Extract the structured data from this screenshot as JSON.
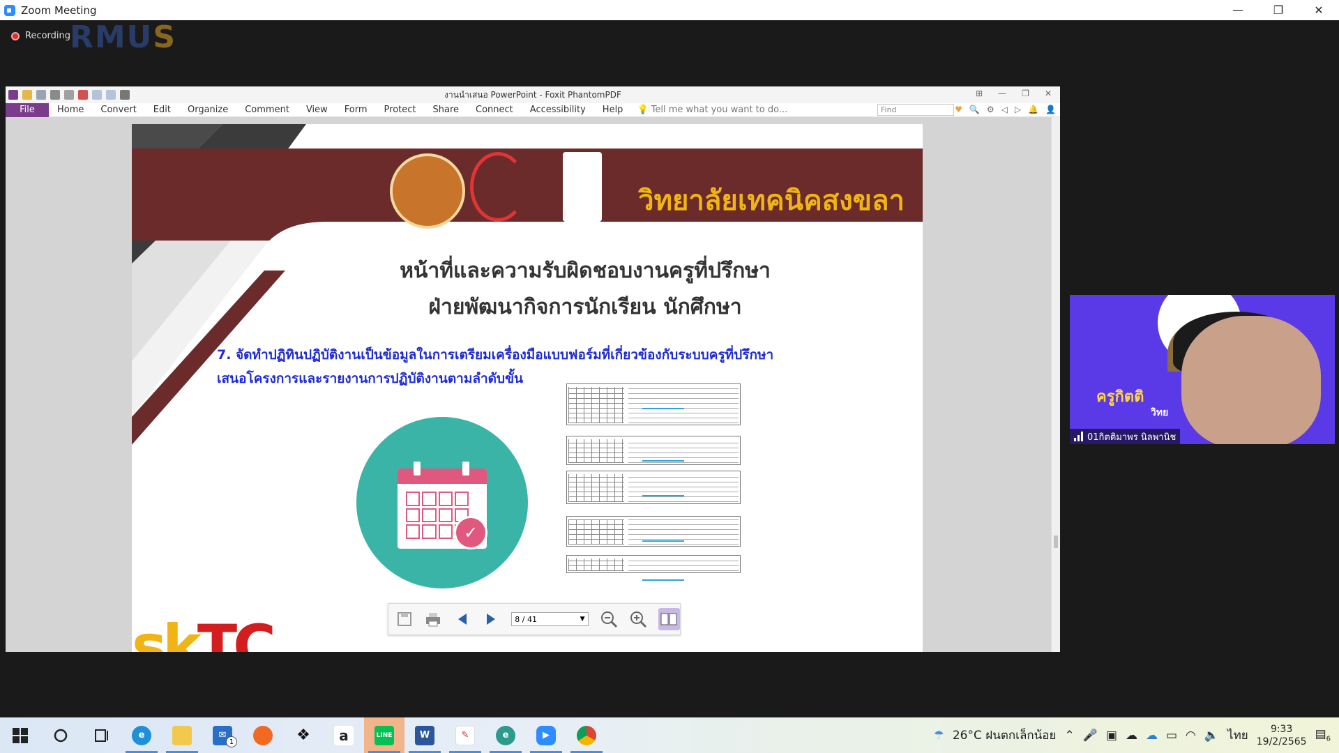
{
  "zoom": {
    "title": "Zoom Meeting",
    "recording_label": "Recording",
    "logo_text_a": "RMU",
    "logo_text_b": "S",
    "minimize": "—",
    "restore": "❐",
    "close": "✕"
  },
  "foxit": {
    "title": "งานนำเสนอ PowerPoint - Foxit PhantomPDF",
    "menu": {
      "file": "File",
      "items": [
        "Home",
        "Convert",
        "Edit",
        "Organize",
        "Comment",
        "View",
        "Form",
        "Protect",
        "Share",
        "Connect",
        "Accessibility",
        "Help"
      ],
      "tell_me_placeholder": "Tell me what you want to do...",
      "find_placeholder": "Find"
    },
    "toolbar": {
      "page_display": "8 / 41"
    }
  },
  "slide": {
    "college_name": "วิทยาลัยเทคนิคสงขลา",
    "title_line1": "หน้าที่และความรับผิดชอบงานครูที่ปรึกษา",
    "title_line2": "ฝ่ายพัฒนากิจการนักเรียน นักศึกษา",
    "point_line1": "7. จัดทำปฏิทินปฏิบัติงานเป็นข้อมูลในการเตรียมเครื่องมือแบบฟอร์มที่เกี่ยวข้องกับระบบครูที่ปรึกษา",
    "point_line2": "เสนอโครงการและรายงานการปฏิบัติงานตามลำดับขั้น",
    "logo_text_main": "sk",
    "logo_text_accent": "TC"
  },
  "participant": {
    "name": "01กิตติมาพร นิลพานิช",
    "overlay_name": "ครูกิตติ",
    "overlay_sub": "วิทย"
  },
  "taskbar": {
    "apps": [
      "start-icon",
      "search-icon",
      "task-view-icon",
      "edge-icon",
      "file-explorer-icon",
      "mail-icon",
      "firefox-icon",
      "dropbox-icon",
      "amazon-icon",
      "line-icon",
      "word-icon",
      "acrobat-icon",
      "edge-dev-icon",
      "zoom-icon",
      "chrome-icon"
    ],
    "mail_badge": "1",
    "weather": "26°C ฝนตกเล็กน้อย",
    "language": "ไทย",
    "time": "9:33",
    "date": "19/2/2565",
    "notification_count": "6"
  }
}
